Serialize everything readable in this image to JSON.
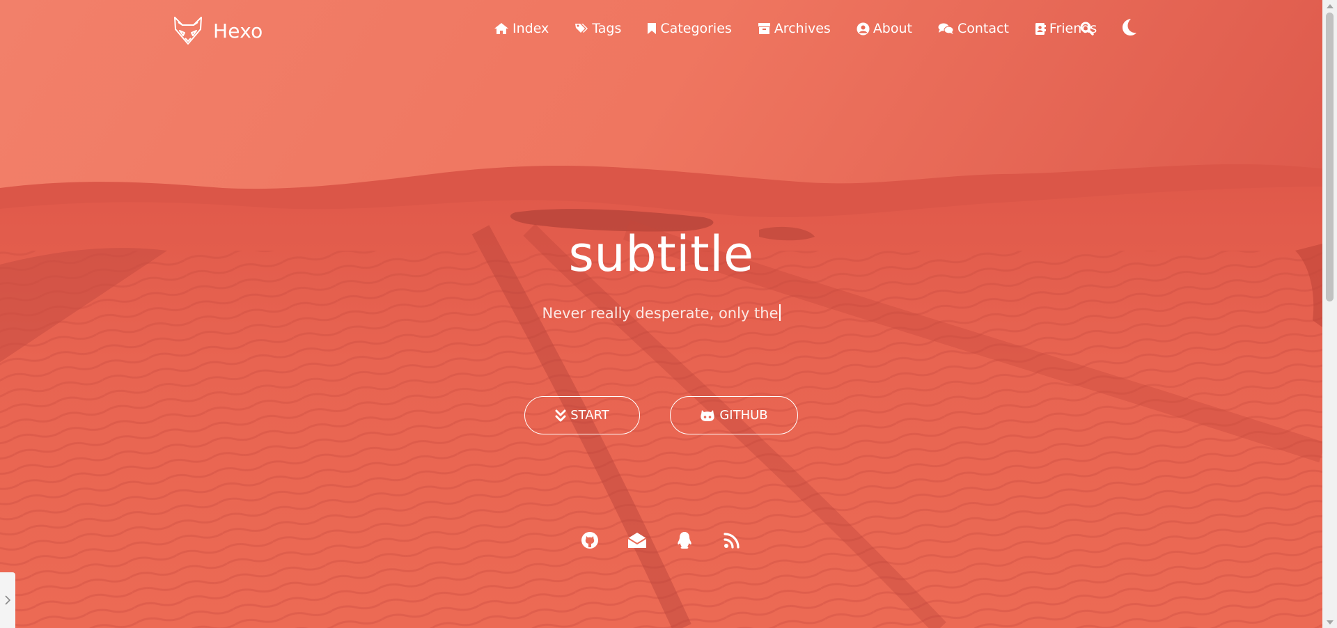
{
  "brand": {
    "name": "Hexo",
    "logo_icon": "fox-head-logo"
  },
  "nav": {
    "items": [
      {
        "label": "Index",
        "icon": "home-icon"
      },
      {
        "label": "Tags",
        "icon": "tags-icon"
      },
      {
        "label": "Categories",
        "icon": "bookmark-icon"
      },
      {
        "label": "Archives",
        "icon": "archive-box-icon"
      },
      {
        "label": "About",
        "icon": "user-circle-icon"
      },
      {
        "label": "Contact",
        "icon": "comments-icon"
      },
      {
        "label": "Friends",
        "icon": "address-book-icon"
      }
    ],
    "search_icon": "search-icon",
    "theme_icon": "moon-icon"
  },
  "hero": {
    "title": "subtitle",
    "typed_text": "Never really desperate, only the",
    "buttons": [
      {
        "label": "START",
        "icon": "angle-double-down-icon"
      },
      {
        "label": "GITHUB",
        "icon": "github-alt-icon"
      }
    ]
  },
  "social": [
    "github-icon",
    "envelope-open-icon",
    "qq-penguin-icon",
    "rss-icon"
  ],
  "colors": {
    "overlay": "#ea6a55",
    "text": "#ffffff"
  }
}
